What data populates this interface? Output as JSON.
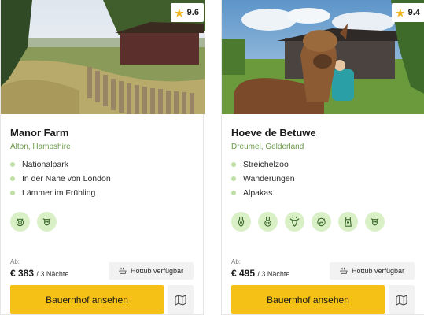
{
  "cards": [
    {
      "rating": "9.6",
      "rating_icon": "star-icon",
      "title": "Manor Farm",
      "location": "Alton, Hampshire",
      "features": [
        "Nationalpark",
        "In der Nähe von London",
        "Lämmer im Frühling"
      ],
      "amenity_icons": [
        "sheep-icon",
        "cow-icon"
      ],
      "price_prefix": "Ab:",
      "price": "€ 383",
      "nights": "/ 3 Nächte",
      "hottub": "Hottub verfügbar",
      "cta": "Bauernhof ansehen",
      "map_icon": "map-icon"
    },
    {
      "rating": "9.4",
      "rating_icon": "star-icon",
      "title": "Hoeve de Betuwe",
      "location": "Dreumel, Gelderland",
      "features": [
        "Streichelzoo",
        "Wanderungen",
        "Alpakas"
      ],
      "amenity_icons": [
        "alpaca-icon",
        "rabbit-icon",
        "goat-icon",
        "pig-icon",
        "llama-icon",
        "cow-icon"
      ],
      "price_prefix": "Ab:",
      "price": "€ 495",
      "nights": "/ 3 Nächte",
      "hottub": "Hottub verfügbar",
      "cta": "Bauernhof ansehen",
      "map_icon": "map-icon"
    }
  ],
  "colors": {
    "accent_yellow": "#f5c116",
    "location_green": "#6c9a4b",
    "icon_bg_green": "#d9efc6",
    "star": "#f0b624"
  }
}
